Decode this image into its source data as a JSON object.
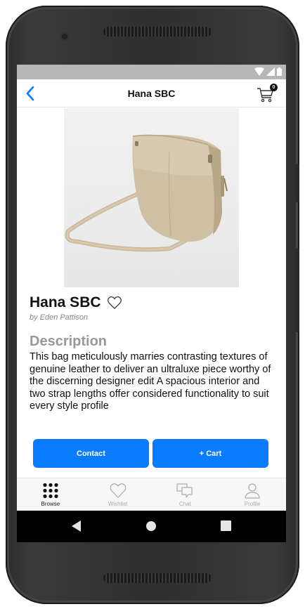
{
  "header": {
    "title": "Hana SBC",
    "cart_count": "0"
  },
  "product": {
    "image_alt": "beige leather saddle bag",
    "title": "Hana SBC",
    "author": "by Eden Pattison",
    "description_heading": "Description",
    "description": "This bag meticulously marries contrasting textures of genuine leather to deliver an ultraluxe piece worthy of the discerning designer edit A spacious interior and two strap lengths offer considered functionality to suit every style profile"
  },
  "actions": {
    "contact_label": "Contact",
    "cart_label": "+ Cart"
  },
  "tabs": [
    {
      "label": "Browse",
      "icon": "grid-icon",
      "active": true
    },
    {
      "label": "Wishlist",
      "icon": "heart-icon",
      "active": false
    },
    {
      "label": "Chat",
      "icon": "chat-icon",
      "active": false
    },
    {
      "label": "Profile",
      "icon": "person-icon",
      "active": false
    }
  ],
  "colors": {
    "accent": "#0a7cff",
    "status_bar": "#b7b7b7",
    "nav_bar": "#000000"
  }
}
